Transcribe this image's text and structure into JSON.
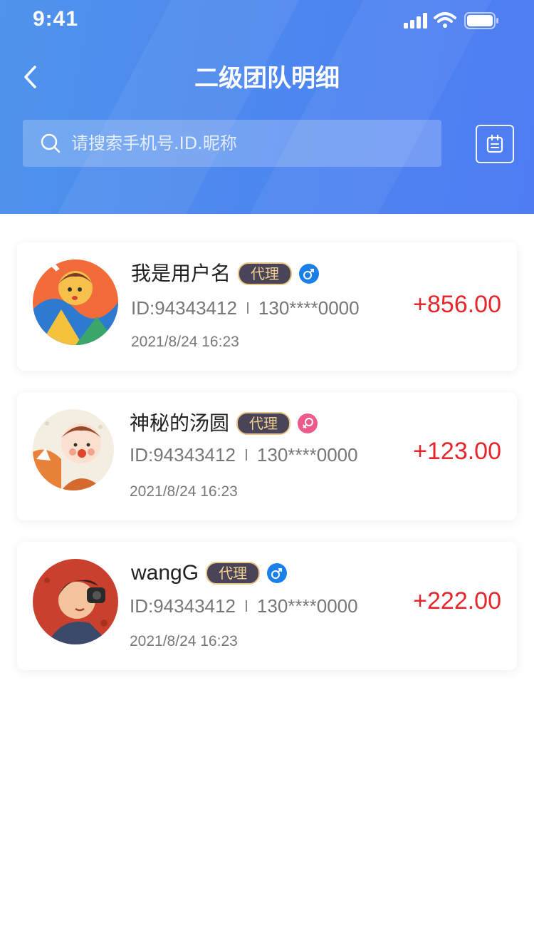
{
  "status_bar": {
    "time": "9:41"
  },
  "header": {
    "title": "二级团队明细",
    "search_placeholder": "请搜索手机号.ID.昵称",
    "search_value": ""
  },
  "members": [
    {
      "name": "我是用户名",
      "role": "代理",
      "gender": "male",
      "id": "ID:94343412",
      "phone": "130****0000",
      "date": "2021/8/24 16:23",
      "amount": "+856.00"
    },
    {
      "name": "神秘的汤圆",
      "role": "代理",
      "gender": "female",
      "id": "ID:94343412",
      "phone": "130****0000",
      "date": "2021/8/24 16:23",
      "amount": "+123.00"
    },
    {
      "name": "wangG",
      "role": "代理",
      "gender": "male",
      "id": "ID:94343412",
      "phone": "130****0000",
      "date": "2021/8/24 16:23",
      "amount": "+222.00"
    }
  ],
  "colors": {
    "header_gradient_start": "#4f93ec",
    "header_gradient_end": "#4f7cf3",
    "amount": "#e5272b",
    "badge_bg": "#4a4458",
    "badge_text": "#f0cf8f",
    "male": "#1a7fe8",
    "female": "#ef5a8c"
  },
  "icons": {
    "back": "chevron-left-icon",
    "search": "search-icon",
    "calendar": "calendar-icon",
    "male": "male-icon",
    "female": "female-icon"
  }
}
